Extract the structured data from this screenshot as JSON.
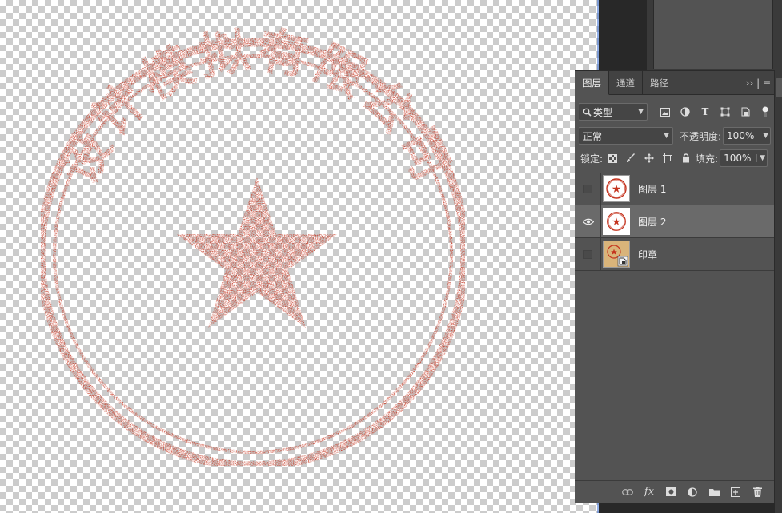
{
  "canvas": {
    "stamp": {
      "arc_text": "设计模拟有限公司",
      "color": "#c4321d"
    }
  },
  "layers_panel": {
    "tabs": [
      {
        "label": "图层",
        "active": true
      },
      {
        "label": "通道",
        "active": false
      },
      {
        "label": "路径",
        "active": false
      }
    ],
    "menu_glyph": "›› | ≡",
    "filter": {
      "kind_label": "类型"
    },
    "blend": {
      "mode": "正常",
      "opacity_label": "不透明度:",
      "opacity_value": "100%"
    },
    "lock": {
      "label": "锁定:",
      "fill_label": "填充:",
      "fill_value": "100%"
    },
    "layers": [
      {
        "name": "图层 1",
        "visible": false,
        "selected": false,
        "thumb": "stamp"
      },
      {
        "name": "图层 2",
        "visible": true,
        "selected": true,
        "thumb": "stamp"
      },
      {
        "name": "印章",
        "visible": false,
        "selected": false,
        "thumb": "smart-object"
      }
    ]
  },
  "colors": {
    "panel_bg": "#535353",
    "tab_bar": "#424242",
    "selected_row": "#6a6a6a",
    "stamp_red": "#c4321d"
  }
}
